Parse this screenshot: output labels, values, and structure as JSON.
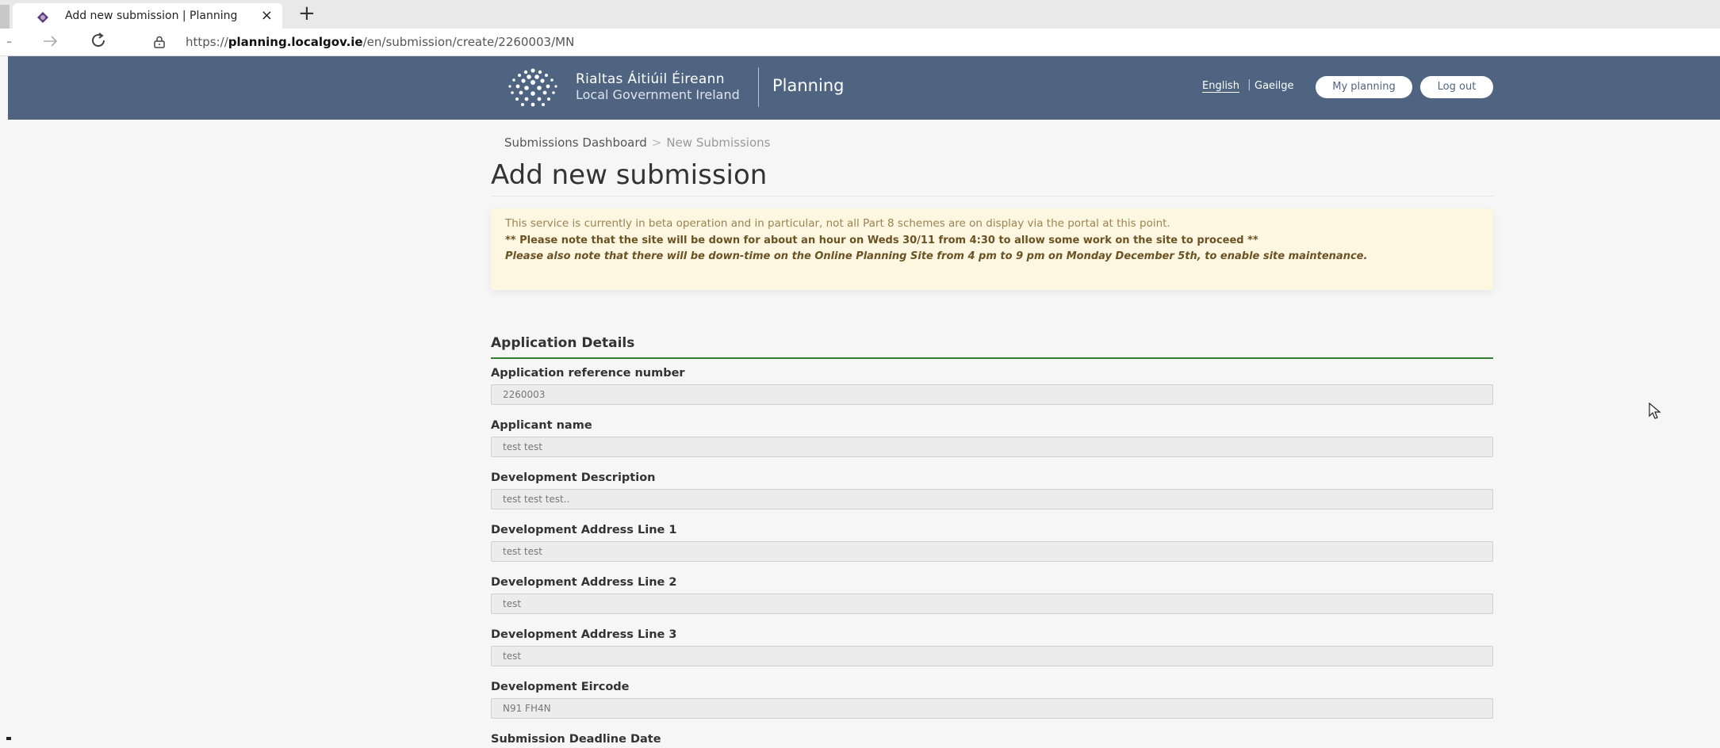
{
  "browser": {
    "tab_title": "Add new submission | Planning",
    "close_glyph": "×",
    "new_tab_glyph": "+",
    "url_prefix": "https://",
    "url_domain": "planning.localgov.ie",
    "url_path": "/en/submission/create/2260003/MN",
    "icons": [
      "favicon-icon",
      "close-icon",
      "plus-icon",
      "back-arrow-icon",
      "forward-arrow-icon",
      "reload-icon",
      "lock-icon"
    ]
  },
  "header": {
    "brand_line1": "Rialtas Áitiúil Éireann",
    "brand_line2": "Local Government Ireland",
    "app_name": "Planning",
    "lang_english": "English",
    "lang_separator": "|",
    "lang_irish": "Gaeilge",
    "my_planning": "My planning",
    "log_out": "Log out",
    "background_color": "#4f6480"
  },
  "breadcrumb": {
    "dashboard": "Submissions Dashboard",
    "separator": ">",
    "current": "New Submissions"
  },
  "page": {
    "title": "Add new submission"
  },
  "notice": {
    "line1": "This service is currently in beta operation and in particular, not all Part 8 schemes are on display via the portal at this point.",
    "line2": "** Please note that the site will be down for about an hour on Weds 30/11 from 4:30 to allow some work on the site to proceed **",
    "line3": "Please also note that there will be down-time on the Online Planning Site from 4 pm to 9 pm on Monday December 5th, to enable site maintenance.",
    "background_color": "#fdf6e1"
  },
  "section": {
    "title": "Application Details",
    "accent_color": "#2e7d32"
  },
  "fields": [
    {
      "label": "Application reference number",
      "value": "2260003"
    },
    {
      "label": "Applicant name",
      "value": "test test"
    },
    {
      "label": "Development Description",
      "value": "test test test.."
    },
    {
      "label": "Development Address Line 1",
      "value": "test test"
    },
    {
      "label": "Development Address Line 2",
      "value": "test"
    },
    {
      "label": "Development Address Line 3",
      "value": "test"
    },
    {
      "label": "Development Eircode",
      "value": "N91 FH4N"
    },
    {
      "label": "Submission Deadline Date",
      "value": ""
    }
  ]
}
